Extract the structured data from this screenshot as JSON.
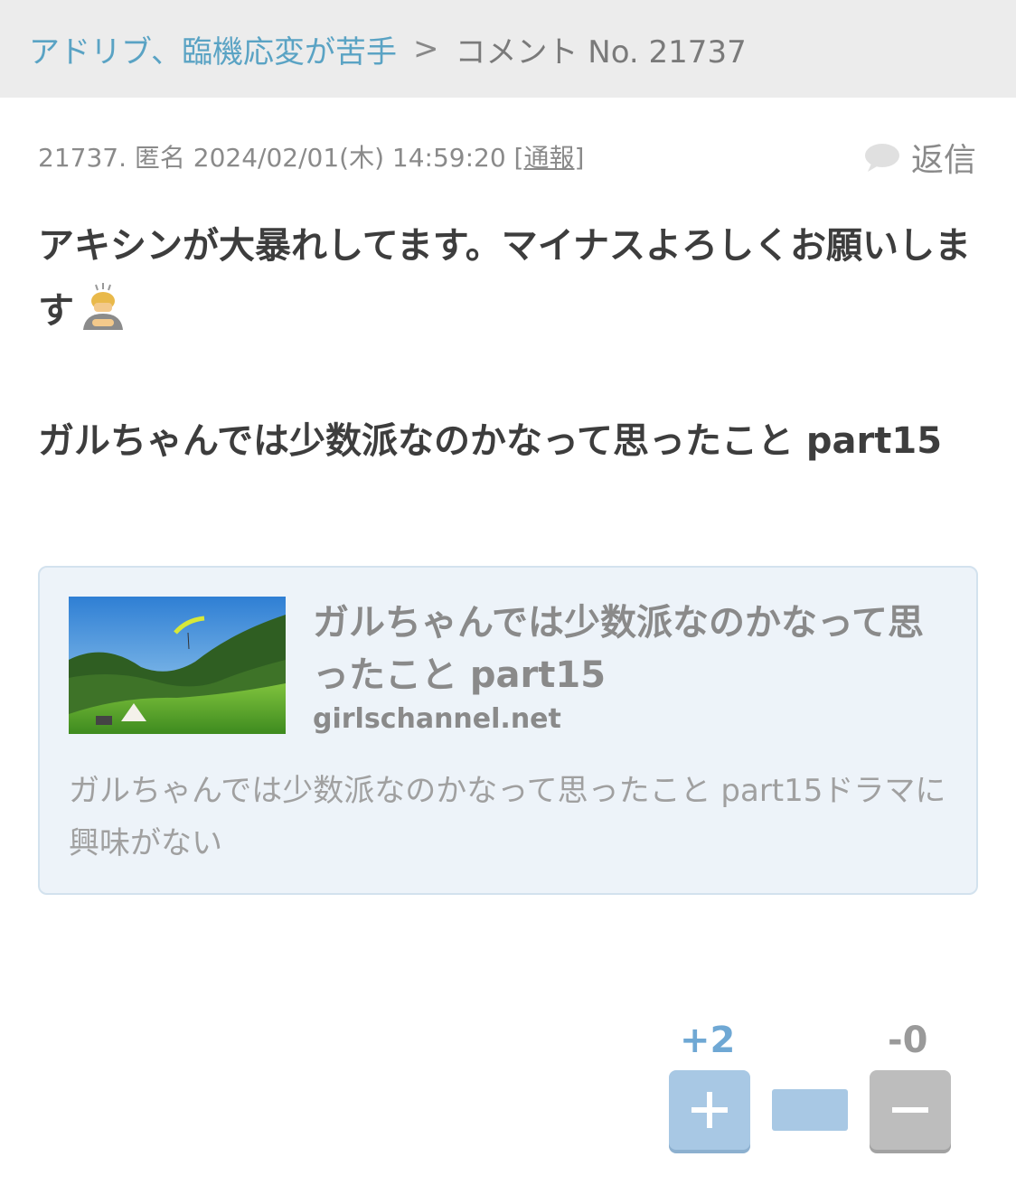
{
  "breadcrumb": {
    "topic": "アドリブ、臨機応変が苦手",
    "separator": ">",
    "current": "コメント No. 21737"
  },
  "comment": {
    "meta_prefix": "21737. 匿名 2024/02/01(木) 14:59:20 [",
    "report_label": "通報",
    "meta_suffix": "]",
    "reply_label": "返信",
    "body_line1": "アキシンが大暴れしてます。マイナスよろしくお願いします",
    "emoji_name": "person-bowing-icon",
    "body_line2": "ガルちゃんでは少数派なのかなって思ったこと part15"
  },
  "link_card": {
    "title": "ガルちゃんでは少数派なのかなって思ったこと part15",
    "domain": "girlschannel.net",
    "description": "ガルちゃんでは少数派なのかなって思ったこと part15ドラマに興味がない"
  },
  "votes": {
    "plus_count": "+2",
    "minus_count": "-0",
    "plus_ratio": 1.0
  },
  "colors": {
    "link": "#5aa3c4",
    "plus": "#6fa8d4",
    "card_bg": "#edf3f9"
  }
}
